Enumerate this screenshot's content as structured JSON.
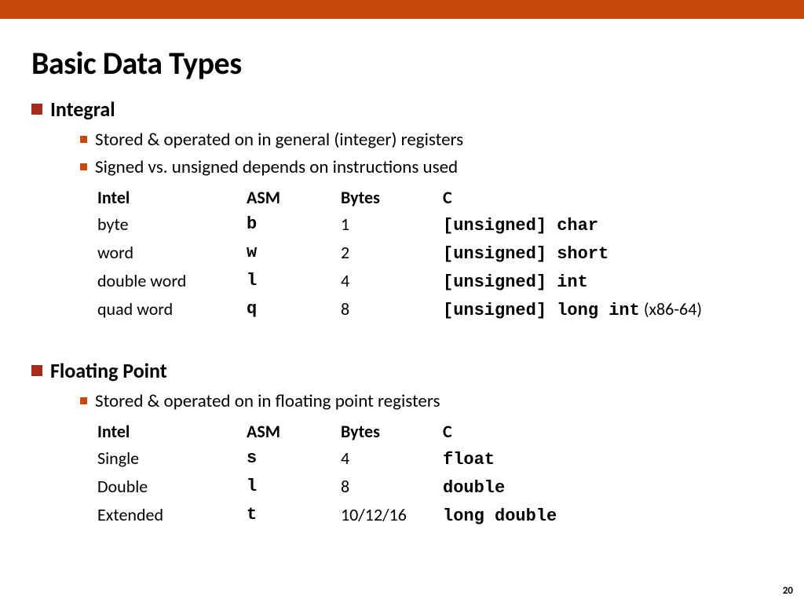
{
  "title": "Basic Data Types",
  "page_number": "20",
  "columns": {
    "intel": "Intel",
    "asm": "ASM",
    "bytes": "Bytes",
    "c": "C"
  },
  "sections": [
    {
      "title": "Integral",
      "bullets": [
        "Stored & operated on in general (integer) registers",
        "Signed vs. unsigned depends on instructions used"
      ],
      "rows": [
        {
          "intel": "byte",
          "asm": "b",
          "bytes": "1",
          "c": "[unsigned] char",
          "note": ""
        },
        {
          "intel": "word",
          "asm": "w",
          "bytes": "2",
          "c": "[unsigned] short",
          "note": ""
        },
        {
          "intel": "double word",
          "asm": "l",
          "bytes": "4",
          "c": "[unsigned] int",
          "note": ""
        },
        {
          "intel": "quad word",
          "asm": "q",
          "bytes": "8",
          "c": "[unsigned] long int",
          "note": " (x86-64)"
        }
      ]
    },
    {
      "title": "Floating Point",
      "bullets": [
        "Stored & operated on in floating point registers"
      ],
      "rows": [
        {
          "intel": "Single",
          "asm": "s",
          "bytes": "4",
          "c": "float",
          "note": ""
        },
        {
          "intel": "Double",
          "asm": "l",
          "bytes": "8",
          "c": "double",
          "note": ""
        },
        {
          "intel": "Extended",
          "asm": "t",
          "bytes": "10/12/16",
          "c": "long double",
          "note": ""
        }
      ]
    }
  ]
}
